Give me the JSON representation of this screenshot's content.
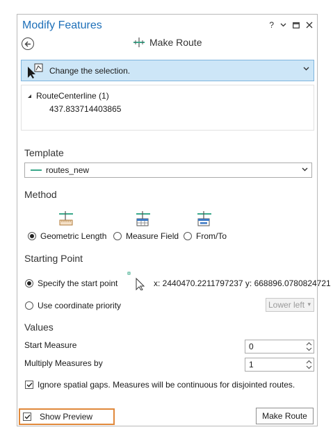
{
  "window": {
    "title": "Modify Features",
    "help_label": "?"
  },
  "tool": {
    "title": "Make Route"
  },
  "selection": {
    "prompt": "Change the selection.",
    "layer": "RouteCenterline (1)",
    "feature_value": "437.833714403865"
  },
  "template": {
    "heading": "Template",
    "value": "routes_new"
  },
  "method": {
    "heading": "Method",
    "options": [
      {
        "label": "Geometric Length",
        "selected": true
      },
      {
        "label": "Measure Field",
        "selected": false
      },
      {
        "label": "From/To",
        "selected": false
      }
    ]
  },
  "starting_point": {
    "heading": "Starting Point",
    "specify_label": "Specify the start point",
    "coordinates": "x: 2440470.2211797237 y: 668896.0780824721",
    "priority_label": "Use coordinate priority",
    "priority_value": "Lower left"
  },
  "values": {
    "heading": "Values",
    "start_measure_label": "Start Measure",
    "start_measure_value": "0",
    "multiply_label": "Multiply Measures by",
    "multiply_value": "1",
    "ignore_gaps_label": "Ignore spatial gaps. Measures will be continuous for disjointed routes.",
    "ignore_gaps_checked": true
  },
  "footer": {
    "show_preview_label": "Show Preview",
    "show_preview_checked": true,
    "make_route_label": "Make Route"
  },
  "colors": {
    "title_blue": "#1d6fb8",
    "selection_bar": "#cde6f7",
    "highlight_orange": "#e0883a",
    "template_swatch": "#3aa88a"
  }
}
